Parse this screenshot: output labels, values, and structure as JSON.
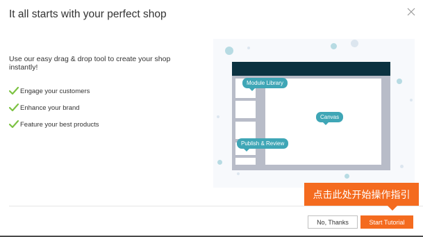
{
  "dialog": {
    "title": "It all starts with your perfect shop",
    "close_icon": "close-icon",
    "intro": "Use our easy drag & drop tool to create your shop instantly!",
    "features": [
      "Engage your customers",
      "Enhance your brand",
      "Feature your best products"
    ],
    "check_icon": "checkmark-icon",
    "check_color": "#7cc242"
  },
  "illustration": {
    "module_library_label": "Module Library",
    "canvas_label": "Canvas",
    "publish_label": "Publish & Review",
    "header_color": "#0b3240",
    "tag_color": "#3fa6b6"
  },
  "footer": {
    "cancel_label": "No, Thanks",
    "start_label": "Start Tutorial",
    "accent_color": "#f46b1f"
  },
  "callout": {
    "text": "点击此处开始操作指引"
  }
}
